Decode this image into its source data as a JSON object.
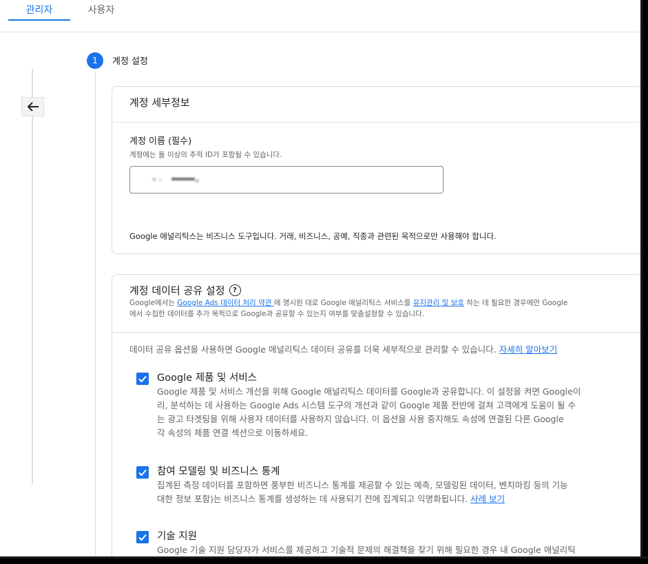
{
  "tabs": [
    {
      "label": "관리자",
      "active": true
    },
    {
      "label": "사용자",
      "active": false
    }
  ],
  "step": {
    "number": "1",
    "title": "계정 설정"
  },
  "account_details": {
    "header": "계정 세부정보",
    "name_label": "계정 이름 (필수)",
    "name_help": "계정에는 둘 이상의 추적 ID가 포함될 수 있습니다.",
    "note": "Google 애널리틱스는 비즈니스 도구입니다. 거래, 비즈니스, 공예, 직종과 관련된 목적으로만 사용해야 합니다."
  },
  "data_sharing": {
    "header": "계정 데이터 공유 설정",
    "desc_line1_prefix": "Google에서는 ",
    "desc_link1": "Google Ads 데이터 처리 약관 ",
    "desc_line1_mid": "에 명시된 대로 Google 애널리틱스 서비스를 ",
    "desc_link2": "유지관리 및 보호",
    "desc_line1_suffix": " 하는 데 필요한 경우에만 Google",
    "desc_line2": "에서 수집한 데이터를 추가 목적으로 Google과 공유할 수 있는지 여부를 맞춤설정할 수 있습니다.",
    "intro_text": "데이터 공유 옵션을 사용하면 Google 애널리틱스 데이터 공유를 더욱 세부적으로 관리할 수 있습니다. ",
    "intro_link": "자세히 알아보기",
    "options": [
      {
        "title": "Google 제품 및 서비스",
        "checked": true,
        "lines": [
          "Google 제품 및 서비스 개선을 위해 Google 애널리틱스 데이터를 Google과 공유합니다. 이 설정을 켜면 Google이",
          "리, 분석하는 데 사용하는 Google Ads 시스템 도구의 개선과 같이 Google 제품 전반에 걸쳐 고객에게 도움이 될 수",
          "는 광고 타겟팅을 위해 사용자 데이터를 사용하지 않습니다. 이 옵션을 사용 중지해도 속성에 연결된 다른 Google",
          "각 속성의 제품 연결 섹션으로 이동하세요."
        ]
      },
      {
        "title": "참여 모델링 및 비즈니스 통계",
        "checked": true,
        "lines": [
          "집계된 측정 데이터를 포함하면 풍부한 비즈니스 통계를 제공할 수 있는 예측, 모델링된 데이터, 벤치마킹 등의 기능",
          "대한 정보 포함)는 비즈니스 통계를 생성하는 데 사용되기 전에 집계되고 익명화됩니다. "
        ],
        "link": "사례 보기"
      },
      {
        "title": "기술 지원",
        "checked": true,
        "lines": [
          "Google 기술 지원 담당자가 서비스를 제공하고 기술적 문제의 해결책을 찾기 위해 필요한 경우 내 Google 애널리틱"
        ]
      }
    ]
  }
}
